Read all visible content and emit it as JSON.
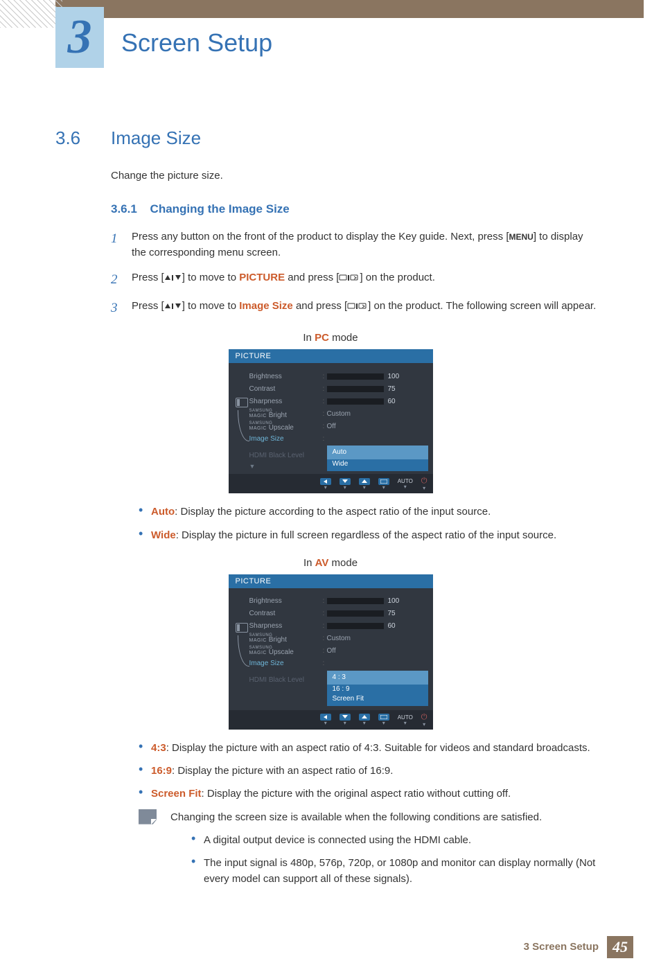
{
  "chapter": {
    "number": "3",
    "title": "Screen Setup"
  },
  "section": {
    "number": "3.6",
    "title": "Image Size",
    "intro": "Change the picture size."
  },
  "subsection": {
    "number": "3.6.1",
    "title": "Changing the Image Size"
  },
  "steps": {
    "s1_num": "1",
    "s1_a": "Press any button on the front of the product to display the Key guide. Next, press [",
    "s1_menu": "MENU",
    "s1_b": "] to display the corresponding menu screen.",
    "s2_num": "2",
    "s2_a": "Press [",
    "s2_b": "] to move to ",
    "s2_picture": "PICTURE",
    "s2_c": " and press [",
    "s2_d": "] on the product.",
    "s3_num": "3",
    "s3_a": "Press [",
    "s3_b": "] to move to ",
    "s3_img": "Image Size",
    "s3_c": " and press [",
    "s3_d": "] on the product. The following screen will appear."
  },
  "modes": {
    "pc_prefix": "In ",
    "pc_hl": "PC",
    "pc_suffix": " mode",
    "av_prefix": "In ",
    "av_hl": "AV",
    "av_suffix": " mode"
  },
  "osd": {
    "title": "PICTURE",
    "rows": {
      "brightness": {
        "label": "Brightness",
        "value": "100",
        "fill": 100
      },
      "contrast": {
        "label": "Contrast",
        "value": "75",
        "fill": 75
      },
      "sharpness": {
        "label": "Sharpness",
        "value": "60",
        "fill": 60
      },
      "magic_bright": {
        "brand": "SAMSUNG",
        "magic": "MAGIC",
        "suffix": "Bright",
        "value": "Custom"
      },
      "magic_upscale": {
        "brand": "SAMSUNG",
        "magic": "MAGIC",
        "suffix": "Upscale",
        "value": "Off"
      },
      "image_size": {
        "label": "Image Size"
      },
      "hdmi": {
        "label": "HDMI Black Level"
      }
    },
    "pc_options": [
      "Auto",
      "Wide"
    ],
    "av_options": [
      "4 : 3",
      "16 : 9",
      "Screen Fit"
    ],
    "footer_auto": "AUTO"
  },
  "pc_bullets": {
    "auto_k": "Auto",
    "auto_t": ": Display the picture according to the aspect ratio of the input source.",
    "wide_k": "Wide",
    "wide_t": ": Display the picture in full screen regardless of the aspect ratio of the input source."
  },
  "av_bullets": {
    "b43_k": "4:3",
    "b43_t": ": Display the picture with an aspect ratio of 4:3. Suitable for videos and standard broadcasts.",
    "b169_k": "16:9",
    "b169_t": ": Display the picture with an aspect ratio of 16:9.",
    "sf_k": "Screen Fit",
    "sf_t": ": Display the picture with the original aspect ratio without cutting off."
  },
  "note": {
    "lead": "Changing the screen size is available when the following conditions are satisfied.",
    "c1": "A digital output device is connected using the HDMI cable.",
    "c2": "The input signal is 480p, 576p, 720p, or 1080p and monitor can display normally (Not every model can support all of these signals)."
  },
  "footer": {
    "chapter_ref": "3 Screen Setup",
    "page_num": "45"
  }
}
